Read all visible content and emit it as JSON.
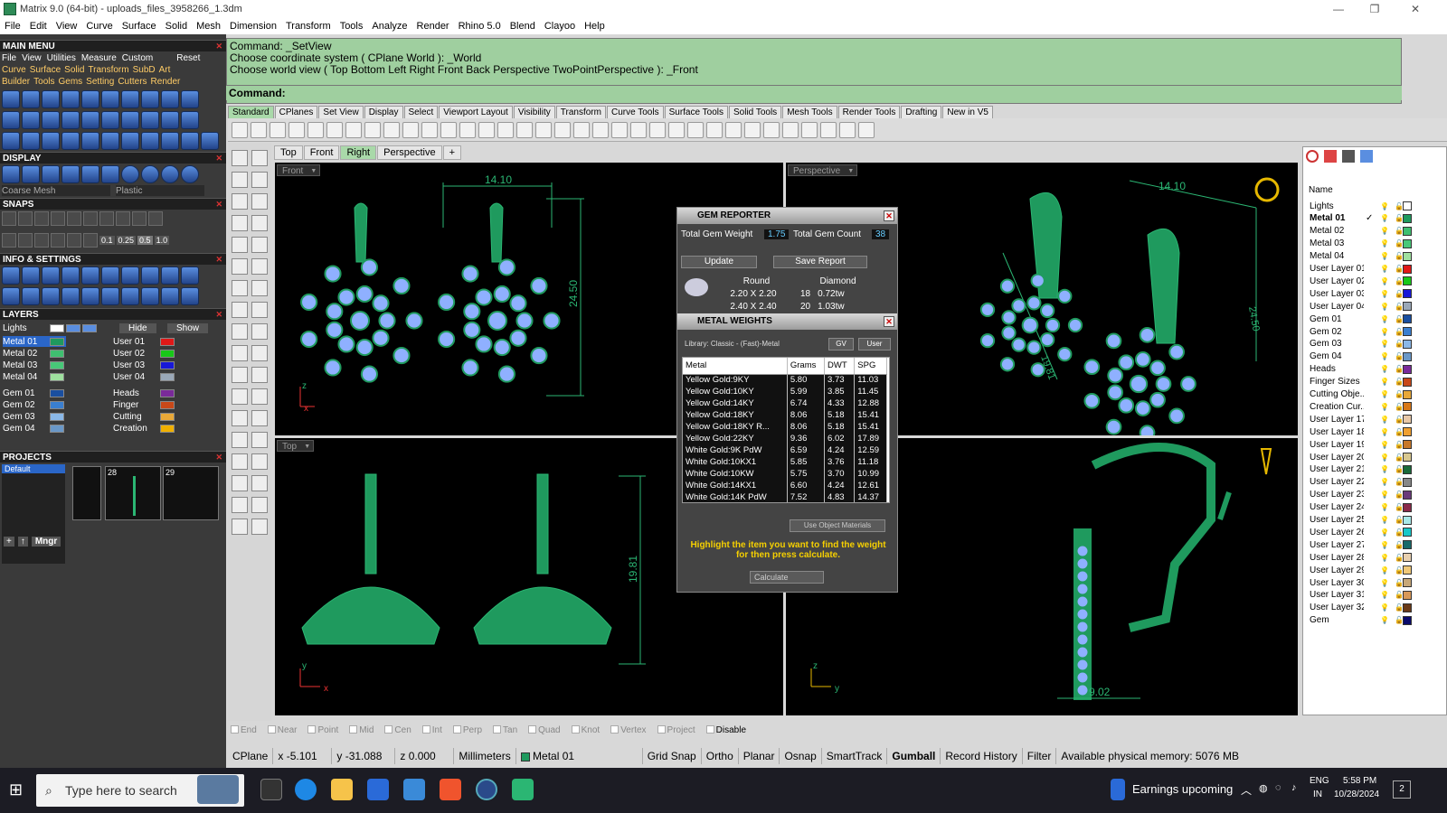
{
  "window": {
    "title": "Matrix 9.0 (64-bit) - uploads_files_3958266_1.3dm"
  },
  "menu": [
    "File",
    "Edit",
    "View",
    "Curve",
    "Surface",
    "Solid",
    "Mesh",
    "Dimension",
    "Transform",
    "Tools",
    "Analyze",
    "Render",
    "Rhino 5.0",
    "Blend",
    "Clayoo",
    "Help"
  ],
  "left": {
    "main_menu": "MAIN MENU",
    "mm_tabs": [
      "File",
      "View",
      "Utilities",
      "Measure",
      "Custom"
    ],
    "reset": "Reset",
    "row1": [
      "Curve",
      "Surface",
      "Solid",
      "Transform",
      "SubD",
      "Art"
    ],
    "row2": [
      "Builder",
      "Tools",
      "Gems",
      "Setting",
      "Cutters",
      "Render"
    ],
    "display": "DISPLAY",
    "coarse_mesh": "Coarse Mesh",
    "plastic": "Plastic",
    "snaps": "SNAPS",
    "snap_vals": [
      "0.1",
      "0.25",
      "0.5",
      "1.0"
    ],
    "info": "INFO & SETTINGS",
    "layers": "LAYERS",
    "lights": "Lights",
    "hide": "Hide",
    "show": "Show",
    "metal_layers": [
      "Metal 01",
      "Metal 02",
      "Metal 03",
      "Metal 04"
    ],
    "gem_layers": [
      "Gem 01",
      "Gem 02",
      "Gem 03",
      "Gem 04"
    ],
    "user_layers": [
      "User 01",
      "User 02",
      "User 03",
      "User 04"
    ],
    "other_layers": [
      "Heads",
      "Finger",
      "Cutting",
      "Creation"
    ],
    "projects": "PROJECTS",
    "default": "Default",
    "thumbs": [
      "28",
      "29"
    ],
    "mngr": "Mngr"
  },
  "command": {
    "lines": [
      "Command: _SetView",
      "Choose coordinate system ( CPlane  World ): _World",
      "Choose world view ( Top  Bottom  Left  Right  Front  Back  Perspective  TwoPointPerspective ): _Front"
    ],
    "prompt": "Command:"
  },
  "tabs": [
    "Standard",
    "CPlanes",
    "Set View",
    "Display",
    "Select",
    "Viewport Layout",
    "Visibility",
    "Transform",
    "Curve Tools",
    "Surface Tools",
    "Solid Tools",
    "Mesh Tools",
    "Render Tools",
    "Drafting",
    "New in V5"
  ],
  "view_tabs": [
    "Top",
    "Front",
    "Right",
    "Perspective"
  ],
  "viewports": {
    "front": {
      "label": "Front",
      "dim_w": "14.10",
      "dim_h": "24.50"
    },
    "perspective": {
      "label": "Perspective",
      "dim_w": "14.10",
      "dim_h": "24.50",
      "dim_d": "19.81"
    },
    "top": {
      "label": "Top",
      "dim_h": "19.81"
    },
    "right": {
      "dim_w": "9.02"
    }
  },
  "gem_reporter": {
    "title": "GEM REPORTER",
    "total_weight_label": "Total Gem Weight",
    "total_weight": "1.75",
    "total_count_label": "Total Gem Count",
    "total_count": "38",
    "update": "Update",
    "save_report": "Save Report",
    "col_shape": "Round",
    "col_type": "Diamond",
    "rows": [
      {
        "size": "2.20 X 2.20",
        "count": "18",
        "ctw": "0.72tw"
      },
      {
        "size": "2.40 X 2.40",
        "count": "20",
        "ctw": "1.03tw"
      }
    ]
  },
  "metal_weights": {
    "title": "METAL WEIGHTS",
    "library": "Library: Classic - (Fast)-Metal",
    "gv": "GV",
    "user": "User",
    "headers": [
      "Metal",
      "Grams",
      "DWT",
      "SPG"
    ],
    "rows": [
      [
        "Yellow Gold:9KY",
        "5.80",
        "3.73",
        "11.03"
      ],
      [
        "Yellow Gold:10KY",
        "5.99",
        "3.85",
        "11.45"
      ],
      [
        "Yellow Gold:14KY",
        "6.74",
        "4.33",
        "12.88"
      ],
      [
        "Yellow Gold:18KY",
        "8.06",
        "5.18",
        "15.41"
      ],
      [
        "Yellow Gold:18KY R...",
        "8.06",
        "5.18",
        "15.41"
      ],
      [
        "Yellow Gold:22KY",
        "9.36",
        "6.02",
        "17.89"
      ],
      [
        "White Gold:9K PdW",
        "6.59",
        "4.24",
        "12.59"
      ],
      [
        "White Gold:10KX1",
        "5.85",
        "3.76",
        "11.18"
      ],
      [
        "White Gold:10KW",
        "5.75",
        "3.70",
        "10.99"
      ],
      [
        "White Gold:14KX1",
        "6.60",
        "4.24",
        "12.61"
      ],
      [
        "White Gold:14K PdW",
        "7.52",
        "4.83",
        "14.37"
      ]
    ],
    "use_object_materials": "Use Object Materials",
    "hint": "Highlight the item you want to find the weight for then press calculate.",
    "calculate": "Calculate"
  },
  "layer_panel": {
    "header": "Name",
    "layers": [
      {
        "name": "Lights",
        "color": "#ffffff"
      },
      {
        "name": "Metal 01",
        "color": "#1f9a5e",
        "current": true
      },
      {
        "name": "Metal 02",
        "color": "#3fbf70"
      },
      {
        "name": "Metal 03",
        "color": "#48c878"
      },
      {
        "name": "Metal 04",
        "color": "#9fe09f"
      },
      {
        "name": "User Layer 01",
        "color": "#e01818"
      },
      {
        "name": "User Layer 02",
        "color": "#18c818"
      },
      {
        "name": "User Layer 03",
        "color": "#1818d8"
      },
      {
        "name": "User Layer 04",
        "color": "#9aa8b8"
      },
      {
        "name": "Gem 01",
        "color": "#1a4fa0"
      },
      {
        "name": "Gem 02",
        "color": "#3a7fd0"
      },
      {
        "name": "Gem 03",
        "color": "#8ab8e8"
      },
      {
        "name": "Gem 04",
        "color": "#6a98c8"
      },
      {
        "name": "Heads",
        "color": "#7a2a9a"
      },
      {
        "name": "Finger Sizes",
        "color": "#c84818"
      },
      {
        "name": "Cutting Obje...",
        "color": "#e8a838"
      },
      {
        "name": "Creation Cur...",
        "color": "#d87818"
      },
      {
        "name": "User Layer 17",
        "color": "#e8c8a8"
      },
      {
        "name": "User Layer 18",
        "color": "#f0a030"
      },
      {
        "name": "User Layer 19",
        "color": "#c87828"
      },
      {
        "name": "User Layer 20",
        "color": "#d8c890"
      },
      {
        "name": "User Layer 21",
        "color": "#1a6a3a"
      },
      {
        "name": "User Layer 22",
        "color": "#888888"
      },
      {
        "name": "User Layer 23",
        "color": "#6a3a7a"
      },
      {
        "name": "User Layer 24",
        "color": "#8a2a4a"
      },
      {
        "name": "User Layer 25",
        "color": "#a8e8e8"
      },
      {
        "name": "User Layer 26",
        "color": "#18c8c8"
      },
      {
        "name": "User Layer 27",
        "color": "#186a6a"
      },
      {
        "name": "User Layer 28",
        "color": "#e8d0b0"
      },
      {
        "name": "User Layer 29",
        "color": "#f0c878"
      },
      {
        "name": "User Layer 30",
        "color": "#c8a878"
      },
      {
        "name": "User Layer 31",
        "color": "#d89858"
      },
      {
        "name": "User Layer 32",
        "color": "#6a3a18"
      },
      {
        "name": "Gem",
        "color": "#0a0a6a"
      }
    ]
  },
  "osnaps": [
    "End",
    "Near",
    "Point",
    "Mid",
    "Cen",
    "Int",
    "Perp",
    "Tan",
    "Quad",
    "Knot",
    "Vertex",
    "Project",
    "Disable"
  ],
  "status": {
    "cplane": "CPlane",
    "x": "x -5.101",
    "y": "y -31.088",
    "z": "z 0.000",
    "units": "Millimeters",
    "layer": "Metal 01",
    "items": [
      "Grid Snap",
      "Ortho",
      "Planar",
      "Osnap",
      "SmartTrack",
      "Gumball",
      "Record History",
      "Filter"
    ],
    "memory": "Available physical memory: 5076 MB"
  },
  "taskbar": {
    "search_placeholder": "Type here to search",
    "earnings": "Earnings upcoming",
    "lang": "ENG",
    "region": "IN",
    "time": "5:58 PM",
    "date": "10/28/2024",
    "notif": "2"
  },
  "colors": {
    "accent_green": "#2bb673",
    "cmd_bg": "#9fcf9f",
    "gem_blue": "#8fb0ff"
  }
}
